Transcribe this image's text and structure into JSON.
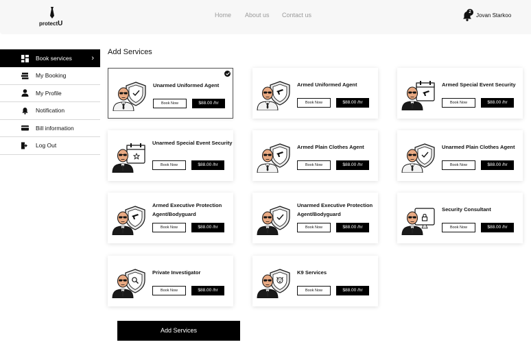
{
  "brand": {
    "name": "protect",
    "suffix": "U"
  },
  "nav": {
    "home": "Home",
    "about": "About us",
    "contact": "Contact us"
  },
  "user": {
    "name": "Jovan Starkoo",
    "notifications": "2"
  },
  "sidebar": {
    "items": [
      {
        "label": "Book services",
        "icon": "grid-icon",
        "active": true
      },
      {
        "label": "My Booking",
        "icon": "book-icon"
      },
      {
        "label": "My Profile",
        "icon": "user-icon"
      },
      {
        "label": "Notification",
        "icon": "bell-icon"
      },
      {
        "label": "Bill information",
        "icon": "card-icon"
      },
      {
        "label": "Log Out",
        "icon": "logout-icon"
      }
    ]
  },
  "main": {
    "title": "Add Services",
    "book_label": "Book Now",
    "add_button": "Add Services",
    "cards": [
      {
        "title": "Unarmed Uniformed Agent",
        "price": "$88.00  /hr",
        "emblem": "check",
        "selected": true
      },
      {
        "title": "Armed Uniformed Agent",
        "price": "$88.00  /hr",
        "emblem": "gun"
      },
      {
        "title": "Armed Special Event Security",
        "price": "$88.00  /hr",
        "emblem": "calendar-gun"
      },
      {
        "title": "Unarmed Special Event Security",
        "price": "$88.00  /hr",
        "emblem": "calendar-star"
      },
      {
        "title": "Armed Plain Clothes Agent",
        "price": "$88.00  /hr",
        "emblem": "gun"
      },
      {
        "title": "Unarmed Plain Clothes Agent",
        "price": "$88.00  /hr",
        "emblem": "check"
      },
      {
        "title": "Armed Executive Protection Agent/Bodyguard",
        "price": "$88.00  /hr",
        "emblem": "gun"
      },
      {
        "title": "Unarmed Executive Protection Agent/Bodyguard",
        "price": "$88.00  /hr",
        "emblem": "check"
      },
      {
        "title": "Security Consultant",
        "price": "$88.00  /hr",
        "emblem": "lock"
      },
      {
        "title": "Private Investigator",
        "price": "$88.00  /hr",
        "emblem": "search"
      },
      {
        "title": "K9 Services",
        "price": "$88.00  /hr",
        "emblem": "dog"
      }
    ]
  }
}
